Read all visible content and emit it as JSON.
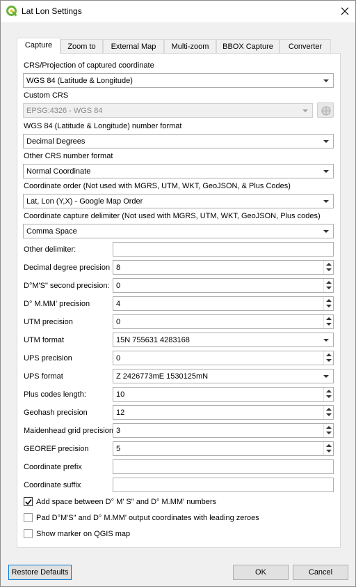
{
  "window": {
    "title": "Lat Lon Settings"
  },
  "tabs": [
    "Capture",
    "Zoom to",
    "External Map",
    "Multi-zoom",
    "BBOX Capture",
    "Converter"
  ],
  "capture": {
    "crs_label": "CRS/Projection of captured coordinate",
    "crs_value": "WGS 84 (Latitude & Longitude)",
    "custom_crs_label": "Custom CRS",
    "custom_crs_value": "EPSG:4326 - WGS 84",
    "wgs84_format_label": "WGS 84 (Latitude & Longitude) number format",
    "wgs84_format_value": "Decimal Degrees",
    "other_crs_label": "Other CRS number format",
    "other_crs_value": "Normal Coordinate",
    "order_label": "Coordinate order (Not used with MGRS, UTM, WKT, GeoJSON, & Plus Codes)",
    "order_value": "Lat, Lon (Y,X) - Google Map Order",
    "delimiter_label": "Coordinate capture delimiter (Not used with MGRS, UTM, WKT, GeoJSON, Plus codes)",
    "delimiter_value": "Comma Space",
    "other_delimiter_label": "Other delimiter:",
    "other_delimiter_value": "",
    "decimal_precision_label": "Decimal degree precision",
    "decimal_precision_value": "8",
    "dms_precision_label": "D°M'S\" second precision:",
    "dms_precision_value": "0",
    "dmm_precision_label": "D° M.MM' precision",
    "dmm_precision_value": "4",
    "utm_precision_label": "UTM precision",
    "utm_precision_value": "0",
    "utm_format_label": "UTM format",
    "utm_format_value": "15N 755631 4283168",
    "ups_precision_label": "UPS precision",
    "ups_precision_value": "0",
    "ups_format_label": "UPS format",
    "ups_format_value": "Z 2426773mE 1530125mN",
    "plus_codes_label": "Plus codes length:",
    "plus_codes_value": "10",
    "geohash_label": "Geohash precision",
    "geohash_value": "12",
    "maidenhead_label": "Maidenhead grid precision",
    "maidenhead_value": "3",
    "georef_label": "GEOREF precision",
    "georef_value": "5",
    "prefix_label": "Coordinate prefix",
    "prefix_value": "",
    "suffix_label": "Coordinate suffix",
    "suffix_value": "",
    "checkboxes": [
      {
        "label": "Add space between D° M' S\" and D° M.MM' numbers",
        "checked": true
      },
      {
        "label": "Pad D°M'S\" and D° M.MM' output coordinates with leading zeroes",
        "checked": false
      },
      {
        "label": "Show marker on QGIS map",
        "checked": false
      }
    ]
  },
  "buttons": {
    "restore": "Restore Defaults",
    "ok": "OK",
    "cancel": "Cancel"
  },
  "colors": {
    "app_icon": "#6cb13b",
    "focus_border": "#0078d7"
  }
}
